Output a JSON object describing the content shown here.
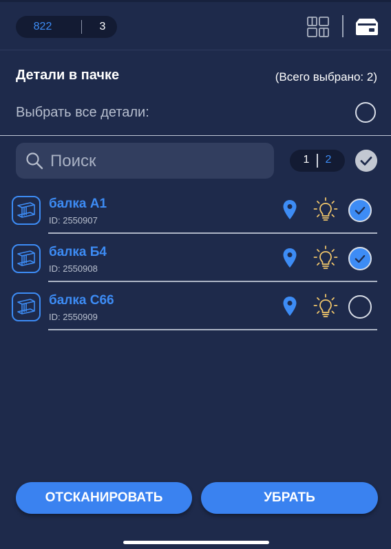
{
  "header": {
    "counter_a": "822",
    "counter_b": "3",
    "icons": [
      "grid-icon",
      "box-icon"
    ]
  },
  "section": {
    "title": "Детали в пачке",
    "total_selected": "(Всего выбрано: 2)",
    "select_all_label": "Выбрать все детали:",
    "select_all_checked": false
  },
  "search": {
    "placeholder": "Поиск",
    "value": ""
  },
  "pager": {
    "current": "1",
    "total": "2"
  },
  "items": [
    {
      "name": "балка А1",
      "id_text": "ID: 2550907",
      "checked": true
    },
    {
      "name": "балка Б4",
      "id_text": "ID: 2550908",
      "checked": true
    },
    {
      "name": "балка С66",
      "id_text": "ID: 2550909",
      "checked": false
    }
  ],
  "buttons": {
    "scan": "ОТСКАНИРОВАТЬ",
    "remove": "УБРАТЬ"
  },
  "colors": {
    "background": "#1e2a4b",
    "accent": "#3d8cf5",
    "bulb": "#f2c76b"
  }
}
